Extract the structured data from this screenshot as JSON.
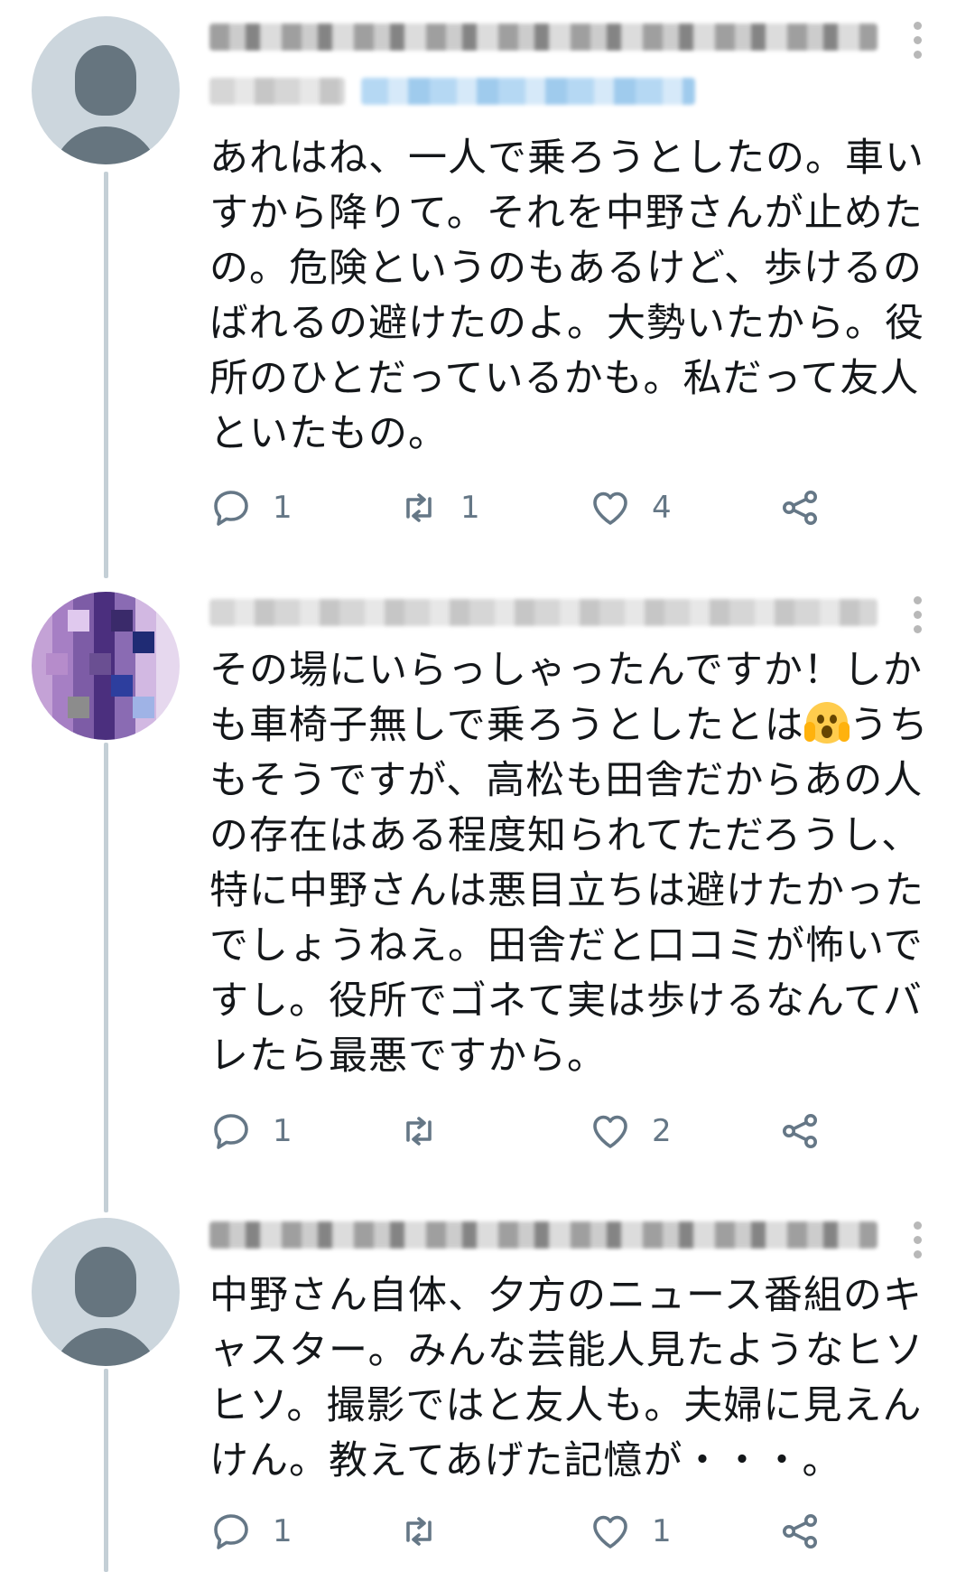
{
  "tweets": [
    {
      "text": "あれはね、一人で乗ろうとしたの。車いすから降りて。それを中野さんが止めたの。危険というのもあるけど、歩けるのばれるの避けたのよ。大勢いたから。役所のひとだっているかも。私だって友人といたもの。",
      "text_after_emoji": "",
      "has_emoji": false,
      "replies": "1",
      "retweets": "1",
      "likes": "4",
      "avatar": "default-avatar"
    },
    {
      "text": "その場にいらっしゃったんですか！しかも車椅子無しで乗ろうとしたとは",
      "text_after_emoji": "うちもそうですが、高松も田舎だからあの人の存在はある程度知られてただろうし、特に中野さんは悪目立ちは避けたかったでしょうねえ。田舎だと口コミが怖いですし。役所でゴネて実は歩けるなんてバレたら最悪ですから。",
      "has_emoji": true,
      "emoji": "face-screaming-in-fear",
      "replies": "1",
      "retweets": "",
      "likes": "2",
      "avatar": "photo-avatar"
    },
    {
      "text": "中野さん自体、夕方のニュース番組のキャスター。みんな芸能人見たようなヒソヒソ。撮影ではと友人も。夫婦に見えんけん。教えてあげた記憶が・・・。",
      "text_after_emoji": "",
      "has_emoji": false,
      "replies": "1",
      "retweets": "",
      "likes": "1",
      "avatar": "default-avatar"
    }
  ],
  "colors": {
    "icon": "#657786",
    "thread_line": "#c4cfd6",
    "avatar_bg": "#ccd6dd",
    "text": "#14171a"
  },
  "icons": [
    "reply-icon",
    "retweet-icon",
    "like-icon",
    "share-icon",
    "more-icon"
  ]
}
